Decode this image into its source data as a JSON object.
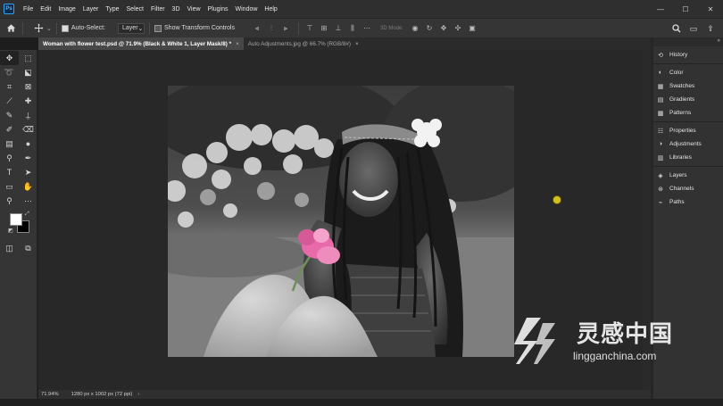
{
  "app": {
    "logo": "Ps"
  },
  "menu": [
    "File",
    "Edit",
    "Image",
    "Layer",
    "Type",
    "Select",
    "Filter",
    "3D",
    "View",
    "Plugins",
    "Window",
    "Help"
  ],
  "window_controls": {
    "minimize": "—",
    "maximize": "☐",
    "close": "✕"
  },
  "options": {
    "auto_select_label": "Auto-Select:",
    "layer_select_value": "Layer",
    "show_transform_label": "Show Transform Controls",
    "mode_3d_label": "3D Mode:"
  },
  "tabs": [
    {
      "label": "Woman with flower test.psd @ 71.9% (Black & White 1, Layer Mask/8) *",
      "close": "×",
      "active": true
    },
    {
      "label": "Auto Adjustments.jpg @ 66.7% (RGB/8#)",
      "close": "×",
      "active": false
    }
  ],
  "status": {
    "zoom": "71.94%",
    "doc_size": "1280 px x 1002 px (72 ppi)",
    "arrow": "›"
  },
  "panels": {
    "group1": [
      "History"
    ],
    "group2": [
      "Color",
      "Swatches",
      "Gradients",
      "Patterns"
    ],
    "group3": [
      "Properties",
      "Adjustments",
      "Libraries"
    ],
    "group4": [
      "Layers",
      "Channels",
      "Paths"
    ]
  },
  "colors": {
    "foreground": "#ffffff",
    "background": "#000000",
    "flower": "#e86aa8"
  },
  "watermark": {
    "cn": "灵感中国",
    "url": "lingganchina.com"
  }
}
